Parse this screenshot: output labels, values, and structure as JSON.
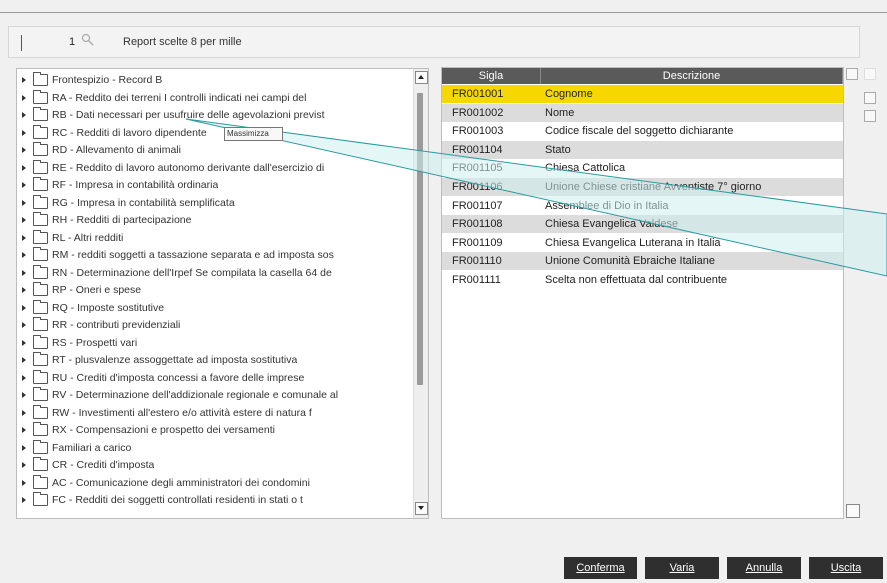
{
  "toolbar": {
    "number": "1",
    "title": "Report scelte 8 per mille"
  },
  "tree": {
    "items": [
      "Frontespizio - Record B",
      "RA - Reddito dei terreni I controlli indicati nei campi del",
      "RB - Dati necessari per usufruire delle agevolazioni previst",
      "RC - Redditi di lavoro dipendente",
      "RD - Allevamento di animali",
      "RE - Reddito di lavoro autonomo derivante dall'esercizio di",
      "RF - Impresa in contabilità ordinaria",
      "RG - Impresa in contabilità semplificata",
      "RH - Redditi di partecipazione",
      "RL - Altri redditi",
      "RM - redditi soggetti a tassazione separata e ad imposta sos",
      "RN - Determinazione dell'Irpef Se compilata la casella 64 de",
      "RP - Oneri e spese",
      "RQ - Imposte sostitutive",
      "RR - contributi previdenziali",
      "RS - Prospetti vari",
      "RT - plusvalenze assoggettate ad imposta sostitutiva",
      "RU - Crediti d'imposta concessi a favore delle imprese",
      "RV - Determinazione dell'addizionale regionale e comunale al",
      "RW - Investimenti all'estero e/o attività estere di natura f",
      "RX - Compensazioni e prospetto dei versamenti",
      "Familiari a carico",
      "CR - Crediti d'imposta",
      "AC - Comunicazione degli amministratori dei condomini",
      "FC - Redditi dei soggetti controllati residenti in stati o t"
    ],
    "tooltip": "Massimizza"
  },
  "grid": {
    "headers": [
      "Sigla",
      "Descrizione"
    ],
    "rows": [
      {
        "sigla": "FR001001",
        "descrizione": "Cognome"
      },
      {
        "sigla": "FR001002",
        "descrizione": "Nome"
      },
      {
        "sigla": "FR001003",
        "descrizione": "Codice fiscale del soggetto dichiarante"
      },
      {
        "sigla": "FR001104",
        "descrizione": "Stato"
      },
      {
        "sigla": "FR001105",
        "descrizione": "Chiesa Cattolica"
      },
      {
        "sigla": "FR001106",
        "descrizione": "Unione Chiese cristiane Avventiste 7° giorno"
      },
      {
        "sigla": "FR001107",
        "descrizione": "Assemblee di Dio in Italia"
      },
      {
        "sigla": "FR001108",
        "descrizione": "Chiesa Evangelica Valdese"
      },
      {
        "sigla": "FR001109",
        "descrizione": "Chiesa Evangelica Luterana in Italia"
      },
      {
        "sigla": "FR001110",
        "descrizione": "Unione Comunità Ebraiche Italiane"
      },
      {
        "sigla": "FR001111",
        "descrizione": "Scelta non effettuata dal contribuente"
      }
    ]
  },
  "buttons": {
    "confirm": "Conferma",
    "vary": "Varia",
    "cancel": "Annulla",
    "exit": "Uscita"
  },
  "colors": {
    "selected_row": "#f6d800",
    "header_bg": "#5a5a5a",
    "callout": "#cfeef0"
  }
}
